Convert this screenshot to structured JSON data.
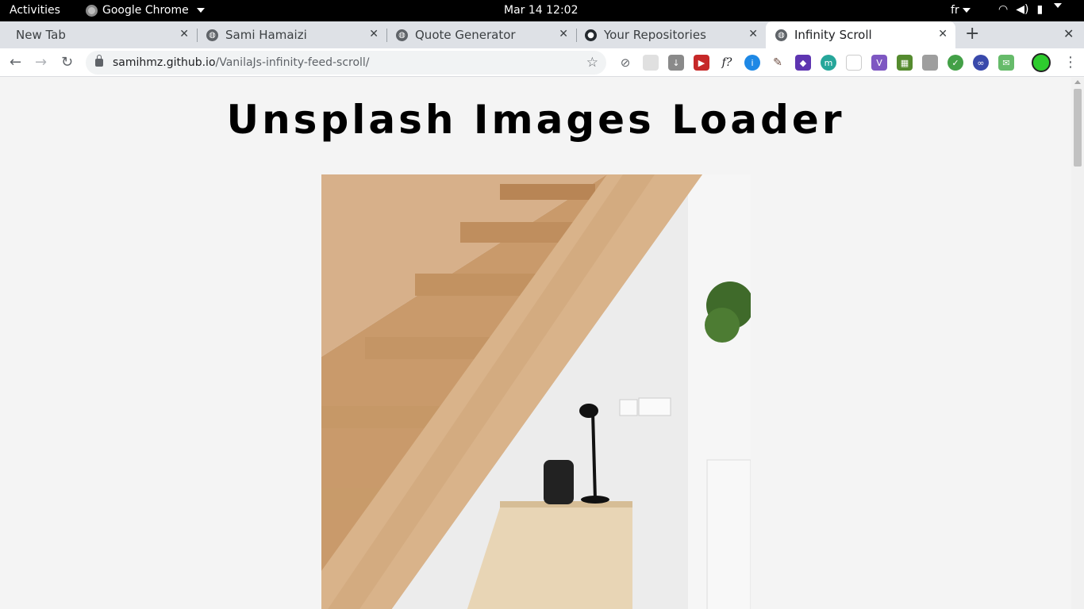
{
  "topbar": {
    "activities": "Activities",
    "app_name": "Google Chrome",
    "clock": "Mar 14  12:02",
    "language": "fr"
  },
  "tabs": [
    {
      "title": "New Tab",
      "icon": "none",
      "active": false
    },
    {
      "title": "Sami Hamaizi",
      "icon": "globe-icon",
      "active": false
    },
    {
      "title": "Quote Generator",
      "icon": "globe-icon",
      "active": false
    },
    {
      "title": "Your Repositories",
      "icon": "github-icon",
      "active": false
    },
    {
      "title": "Infinity Scroll",
      "icon": "globe-icon",
      "active": true
    }
  ],
  "toolbar": {
    "url_host": "samihmz.github.io",
    "url_path": "/VanilaJs-infinity-feed-scroll/"
  },
  "page": {
    "title": "Unsplash Images Loader"
  },
  "colors": {
    "page_bg": "#f4f4f4",
    "tabstrip_bg": "#dee1e6",
    "profile_green": "#2ecc2e"
  }
}
